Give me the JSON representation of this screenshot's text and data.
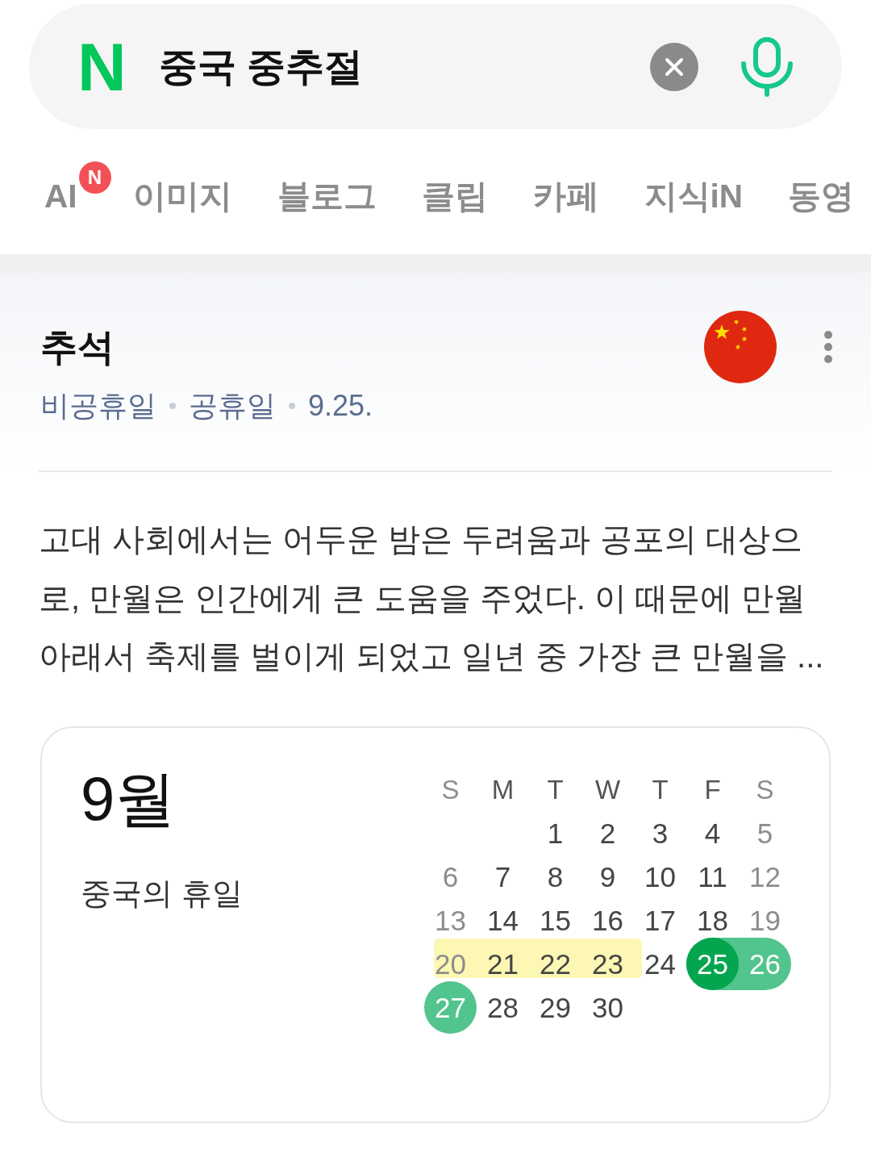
{
  "search": {
    "logo": "N",
    "query": "중국 중추절"
  },
  "tabs": [
    {
      "label": "AI",
      "badge": "N",
      "selected": false
    },
    {
      "label": "이미지",
      "selected": false
    },
    {
      "label": "블로그",
      "selected": false
    },
    {
      "label": "클립",
      "selected": false
    },
    {
      "label": "카페",
      "selected": false
    },
    {
      "label": "지식iN",
      "selected": false
    },
    {
      "label": "동영",
      "selected": false
    }
  ],
  "holiday": {
    "title": "추석",
    "meta": [
      "비공휴일",
      "공휴일",
      "9.25."
    ]
  },
  "description": "고대 사회에서는 어두운 밤은 두려움과 공포의 대상으로, 만월은 인간에게 큰 도움을 주었다. 이 때문에 만월 아래서 축제를 벌이게 되었고 일년 중 가장 큰 만월을 ...",
  "calendar": {
    "month": "9월",
    "caption": "중국의 휴일",
    "weekdays": [
      {
        "label": "S",
        "weekend": true
      },
      {
        "label": "M",
        "weekend": false
      },
      {
        "label": "T",
        "weekend": false
      },
      {
        "label": "W",
        "weekend": false
      },
      {
        "label": "T",
        "weekend": false
      },
      {
        "label": "F",
        "weekend": false
      },
      {
        "label": "S",
        "weekend": true
      }
    ],
    "weeks": [
      {
        "days": [
          {
            "kind": "blank"
          },
          {
            "kind": "blank"
          },
          {
            "kind": "plain",
            "day": "1"
          },
          {
            "kind": "plain",
            "day": "2"
          },
          {
            "kind": "plain",
            "day": "3"
          },
          {
            "kind": "plain",
            "day": "4"
          },
          {
            "kind": "plain",
            "day": "5"
          }
        ]
      },
      {
        "days": [
          {
            "kind": "plain",
            "day": "6"
          },
          {
            "kind": "plain",
            "day": "7"
          },
          {
            "kind": "plain",
            "day": "8"
          },
          {
            "kind": "plain",
            "day": "9"
          },
          {
            "kind": "plain",
            "day": "10"
          },
          {
            "kind": "plain",
            "day": "11"
          },
          {
            "kind": "plain",
            "day": "12"
          }
        ]
      },
      {
        "days": [
          {
            "kind": "plain",
            "day": "13"
          },
          {
            "kind": "plain",
            "day": "14"
          },
          {
            "kind": "plain",
            "day": "15"
          },
          {
            "kind": "plain",
            "day": "16"
          },
          {
            "kind": "plain",
            "day": "17"
          },
          {
            "kind": "plain",
            "day": "18"
          },
          {
            "kind": "plain",
            "day": "19"
          }
        ]
      },
      {
        "days": [
          {
            "kind": "highlighted",
            "day": "20"
          },
          {
            "kind": "highlighted",
            "day": "21"
          },
          {
            "kind": "highlighted",
            "day": "22"
          },
          {
            "kind": "highlighted",
            "day": "23"
          },
          {
            "kind": "plain",
            "day": "24"
          },
          {
            "kind": "holiday",
            "day": "25"
          },
          {
            "kind": "period",
            "day": "26"
          }
        ]
      },
      {
        "days": [
          {
            "kind": "period",
            "day": "27"
          },
          {
            "kind": "plain",
            "day": "28"
          },
          {
            "kind": "plain",
            "day": "29"
          },
          {
            "kind": "plain",
            "day": "30"
          }
        ]
      }
    ]
  }
}
